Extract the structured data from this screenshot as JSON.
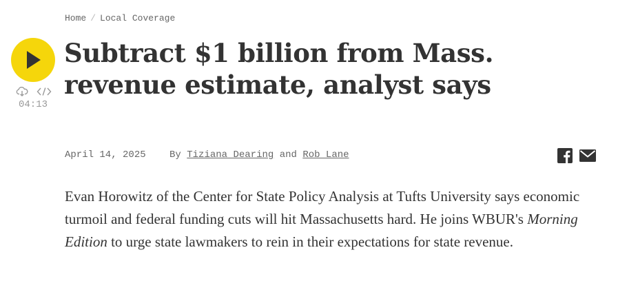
{
  "breadcrumb": {
    "home": "Home",
    "separator": "/",
    "section": "Local Coverage"
  },
  "player": {
    "play_icon": "play-icon",
    "download_icon": "download-cloud-icon",
    "embed_icon": "embed-code-icon",
    "duration": "04:13",
    "accent_color": "#f5d60b"
  },
  "article": {
    "title": "Subtract $1 billion from Mass. revenue estimate, analyst says",
    "date": "April 14, 2025",
    "by_label": "By",
    "authors": [
      "Tiziana Dearing",
      "Rob Lane"
    ],
    "author_joiner": "and",
    "summary_part1": "Evan Horowitz of the Center for State Policy Analysis at Tufts University says economic turmoil and federal funding cuts will hit Massachusetts hard. He joins WBUR's ",
    "summary_italic": "Morning Edition",
    "summary_part2": " to urge state lawmakers to rein in their expectations for state revenue."
  },
  "share": {
    "facebook_icon": "facebook-icon",
    "email_icon": "email-icon"
  }
}
